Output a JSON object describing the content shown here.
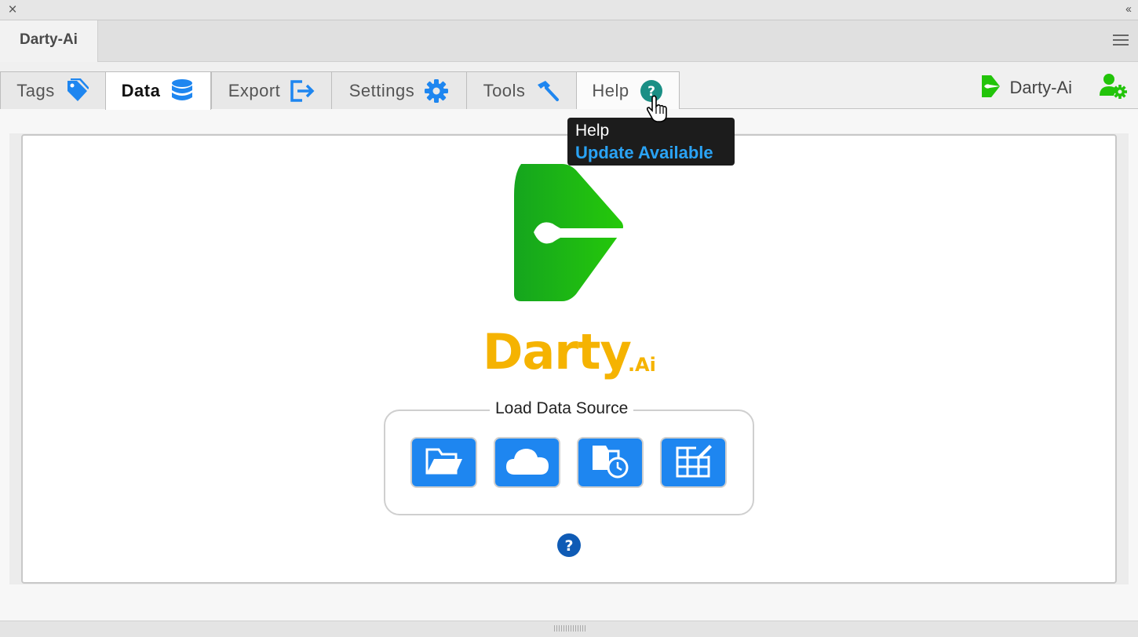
{
  "window": {
    "close_glyph": "×",
    "collapse_glyph": "‹‹"
  },
  "panel": {
    "tab_title": "Darty-Ai"
  },
  "tabs": [
    {
      "label": "Tags",
      "icon": "tag-icon",
      "active": false
    },
    {
      "label": "Data",
      "icon": "database-icon",
      "active": true
    },
    {
      "label": "Export",
      "icon": "export-icon",
      "active": false
    },
    {
      "label": "Settings",
      "icon": "gear-icon",
      "active": false
    },
    {
      "label": "Tools",
      "icon": "hammer-icon",
      "active": false
    },
    {
      "label": "Help",
      "icon": "help-icon",
      "active": false
    }
  ],
  "user": {
    "name": "Darty-Ai"
  },
  "tooltip": {
    "title": "Help",
    "update": "Update Available"
  },
  "brand": {
    "name": "Darty",
    "suffix": ".Ai"
  },
  "data_source": {
    "legend": "Load Data Source",
    "buttons": [
      {
        "name": "open-folder-icon"
      },
      {
        "name": "cloud-icon"
      },
      {
        "name": "recent-folder-icon"
      },
      {
        "name": "edit-table-icon"
      }
    ]
  },
  "colors": {
    "accent_blue": "#1e86f0",
    "brand_green": "#22c40a",
    "brand_yellow": "#f5b301",
    "help_teal": "#1a8f85",
    "tooltip_link": "#2aa3f5"
  }
}
